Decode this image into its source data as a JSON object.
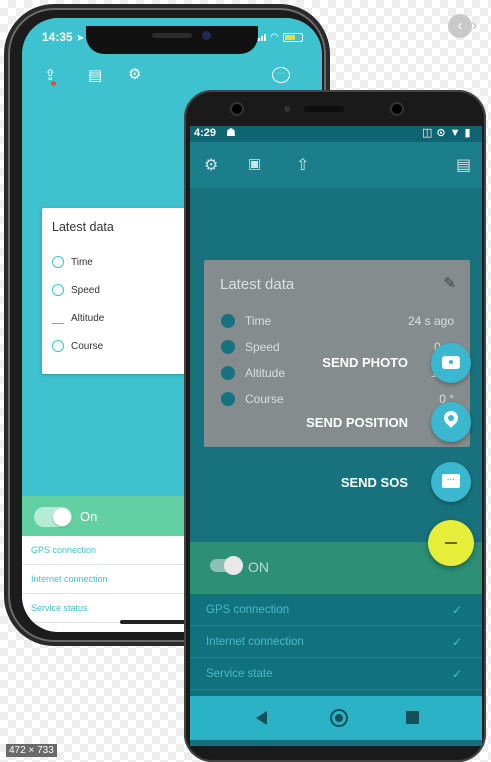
{
  "ios": {
    "status_time": "14:35",
    "card_title": "Latest data",
    "rows": [
      "Time",
      "Speed",
      "Altitude",
      "Course"
    ],
    "toggle_label": "On",
    "list": [
      "GPS connection",
      "Internet connection",
      "Service status"
    ]
  },
  "android": {
    "status_time": "4:29",
    "card_title": "Latest data",
    "rows": [
      {
        "label": "Time",
        "value": "24 s ago"
      },
      {
        "label": "Speed",
        "value": "0 ..."
      },
      {
        "label": "Altitude",
        "value": "10..."
      },
      {
        "label": "Course",
        "value": "0 °"
      }
    ],
    "toggle_label": "ON",
    "list": [
      "GPS connection",
      "Internet connection",
      "Service state"
    ],
    "fab_actions": [
      "SEND PHOTO",
      "SEND POSITION",
      "SEND SOS"
    ]
  },
  "badge": "472 × 733",
  "colors": {
    "ios_teal": "#3ec2d0",
    "ios_toggle_bar": "#62d0a3",
    "android_dark_teal": "#18727d",
    "fab_yellow": "#e7ee3a",
    "fab_mini": "#3bb8cf"
  },
  "icons": {
    "ios_toolbar": [
      "upload-icon",
      "clipboard-icon",
      "gear-icon",
      "chat-icon"
    ],
    "android_toolbar": [
      "gear-icon",
      "camera-video-icon",
      "upload-icon",
      "message-icon"
    ],
    "fab_actions": [
      "camera-icon",
      "location-pin-icon",
      "chat-bubble-icon",
      "minus-icon"
    ]
  }
}
